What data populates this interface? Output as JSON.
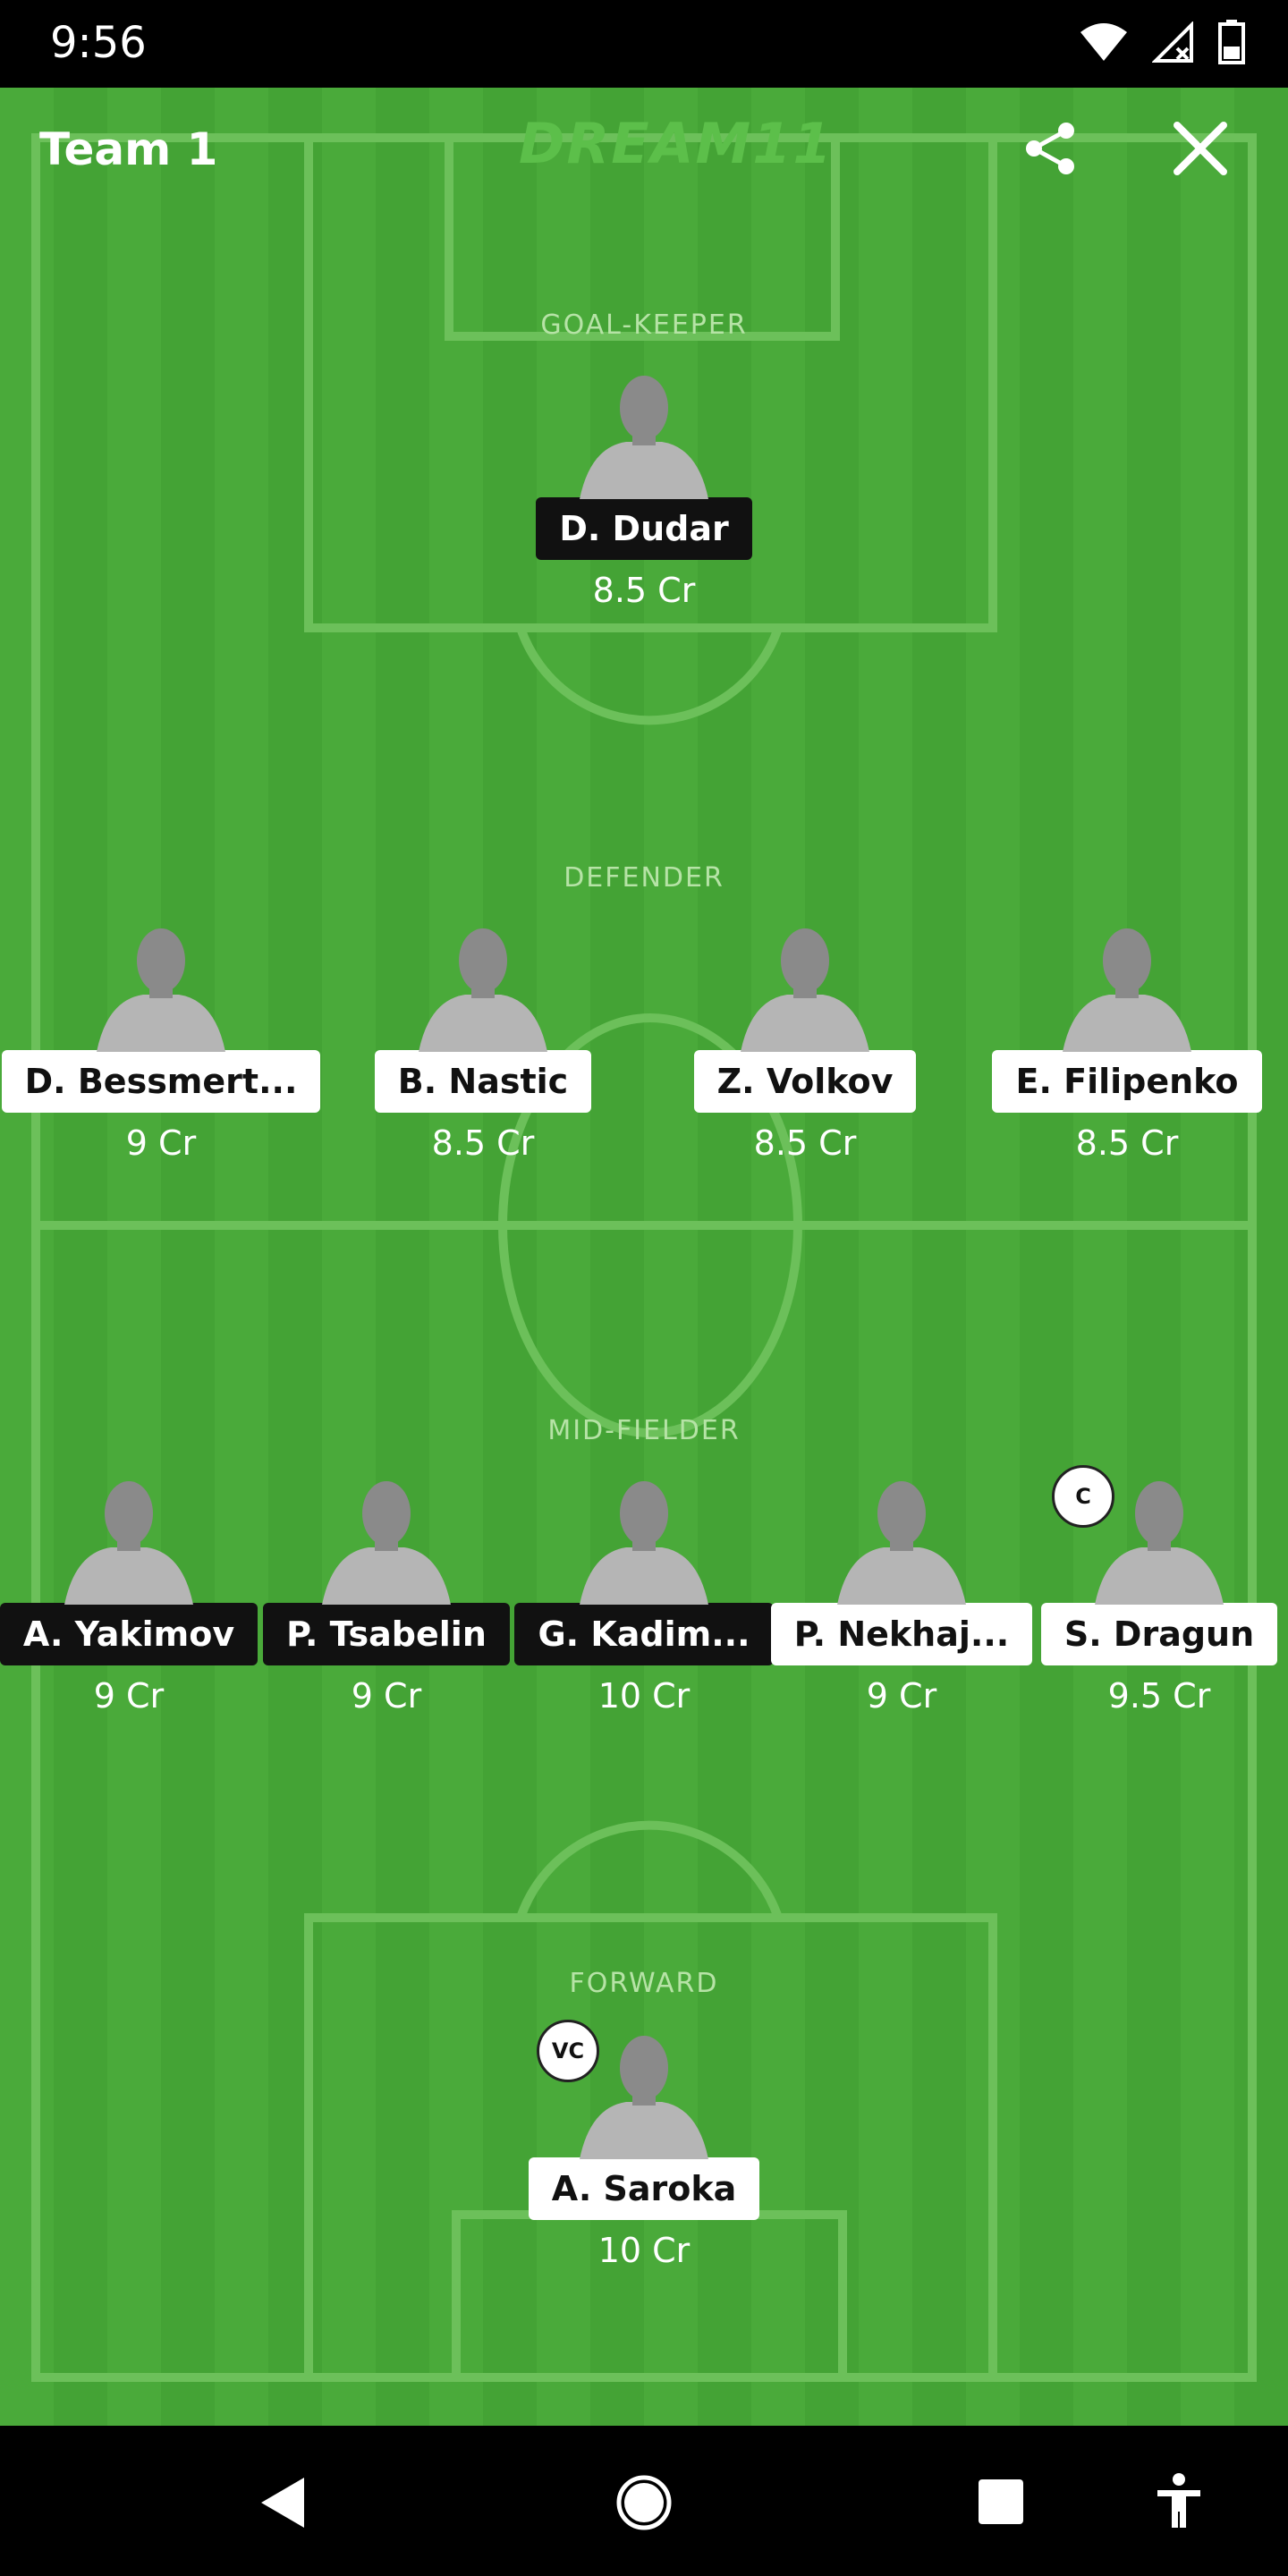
{
  "status_bar": {
    "time": "9:56"
  },
  "header": {
    "team_name": "Team 1",
    "logo_text": "DREAM11"
  },
  "sections": {
    "goalkeeper": "GOAL-KEEPER",
    "defender": "DEFENDER",
    "midfielder": "MID-FIELDER",
    "forward": "FORWARD"
  },
  "players": {
    "gk": [
      {
        "name": "D. Dudar",
        "credits": "8.5 Cr"
      }
    ],
    "def": [
      {
        "name": "D. Bessmert...",
        "credits": "9 Cr"
      },
      {
        "name": "B. Nastic",
        "credits": "8.5 Cr"
      },
      {
        "name": "Z. Volkov",
        "credits": "8.5 Cr"
      },
      {
        "name": "E. Filipenko",
        "credits": "8.5 Cr"
      }
    ],
    "mid": [
      {
        "name": "A. Yakimov",
        "credits": "9 Cr"
      },
      {
        "name": "P. Tsabelin",
        "credits": "9 Cr"
      },
      {
        "name": "G. Kadim...",
        "credits": "10 Cr"
      },
      {
        "name": "P. Nekhaj...",
        "credits": "9 Cr"
      },
      {
        "name": "S. Dragun",
        "credits": "9.5 Cr"
      }
    ],
    "fwd": [
      {
        "name": "A. Saroka",
        "credits": "10 Cr"
      }
    ]
  },
  "badges": {
    "captain": "C",
    "vice_captain": "VC"
  },
  "icons": [
    "wifi-icon",
    "no-signal-icon",
    "battery-icon",
    "share-icon",
    "close-icon",
    "back-icon",
    "home-icon",
    "recents-icon",
    "accessibility-icon"
  ],
  "colors": {
    "field_green": "#4aaa3a",
    "field_line": "#6cc05a"
  }
}
